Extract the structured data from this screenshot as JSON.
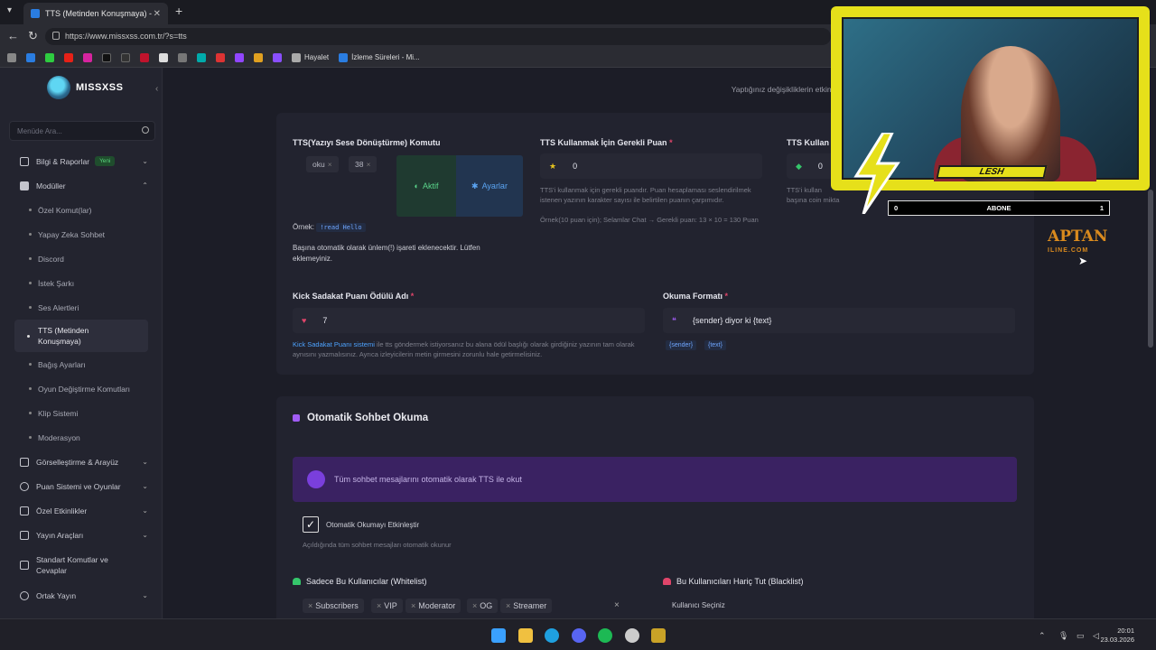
{
  "browser": {
    "tab_title": "TTS (Metinden Konuşmaya) - Mi...",
    "url": "https://www.missxss.com.tr/?s=tts",
    "bookmarks": [
      {
        "label": "Hayalet"
      },
      {
        "label": "İzleme Süreleri - Mi..."
      }
    ]
  },
  "sidebar": {
    "logo": "MISSXSS",
    "search_placeholder": "Menüde Ara...",
    "items": [
      {
        "label": "Bilgi & Raporlar",
        "badge": "Yeni"
      },
      {
        "label": "Modüller"
      },
      {
        "label": "Özel Komut(lar)"
      },
      {
        "label": "Yapay Zeka Sohbet"
      },
      {
        "label": "Discord"
      },
      {
        "label": "İstek Şarkı"
      },
      {
        "label": "Ses Alertleri"
      },
      {
        "label": "TTS (Metinden Konuşmaya)"
      },
      {
        "label": "Bağış Ayarları"
      },
      {
        "label": "Oyun Değiştirme Komutları"
      },
      {
        "label": "Klip Sistemi"
      },
      {
        "label": "Moderasyon"
      },
      {
        "label": "Görselleştirme & Arayüz"
      },
      {
        "label": "Puan Sistemi ve Oyunlar"
      },
      {
        "label": "Özel Etkinlikler"
      },
      {
        "label": "Yayın Araçları"
      },
      {
        "label": "Standart Komutlar ve Cevaplar"
      },
      {
        "label": "Ortak Yayın"
      }
    ]
  },
  "header": {
    "note": "Yaptığınız değişikliklerin etkin olması"
  },
  "tts_card": {
    "command_label": "TTS(Yazıyı Sese Dönüştürme) Komutu",
    "commands": [
      "oku",
      "38"
    ],
    "aktif_label": "Aktif",
    "ayarlar_label": "Ayarlar",
    "ornek_label": "Örnek:",
    "ornek_code": "!read Hello",
    "note": "Başına otomatik olarak ünlem(!) işareti eklenecektir. Lütfen eklemeyiniz.",
    "points_label": "TTS Kullanmak İçin Gerekli Puan",
    "points_value": "0",
    "points_help": "TTS'i kullanmak için gerekli puandır. Puan hesaplaması seslendirilmek istenen yazının karakter sayısı ile belirtilen puanın çarpımıdır.",
    "points_example": "Örnek(10 puan için); Selamlar Chat → Gerekli puan: 13 × 10 = 130 Puan",
    "third_label": "TTS Kullan",
    "third_value": "0",
    "third_help": "TTS'i kullan",
    "third_help2": "başına coin mikta",
    "reward_label": "Kick Sadakat Puanı Ödülü Adı",
    "reward_value": "7",
    "reward_help_link": "Kick Sadakat Puanı sistemi",
    "reward_help": "ile tts göndermek istiyorsanız bu alana ödül başlığı olarak girdiğiniz yazının tam olarak aynısını yazmalısınız. Ayrıca izleyicilerin metin girmesini zorunlu hale getirmelisiniz.",
    "format_label": "Okuma Formatı",
    "format_value": "{sender} diyor ki {text}",
    "format_tags": [
      "{sender}",
      "{text}"
    ]
  },
  "auto_card": {
    "title": "Otomatik Sohbet Okuma",
    "banner": "Tüm sohbet mesajlarını otomatik olarak TTS ile okut",
    "checkbox_label": "Otomatik Okumayı Etkinleştir",
    "checkbox_help": "Açıldığında tüm sohbet mesajları otomatik okunur",
    "whitelist_label": "Sadece Bu Kullanıcılar (Whitelist)",
    "whitelist_chips": [
      "Subscribers",
      "VIP",
      "Moderator",
      "OG",
      "Streamer"
    ],
    "blacklist_label": "Bu Kullanıcıları Hariç Tut (Blacklist)",
    "blacklist_placeholder": "Kullanıcı Seçiniz"
  },
  "overlay": {
    "streamer_name": "LESH",
    "abone_left": "0",
    "abone_label": "ABONE",
    "abone_right": "1",
    "aptan_top": "APTAN",
    "aptan_bottom": "ILINE.COM"
  },
  "taskbar": {
    "time": "20:01",
    "date": "23.03.2026"
  },
  "colors": {
    "accent_purple": "#a15cf5",
    "aktif_green": "#5ad48a",
    "ayarlar_blue": "#5aa4f2",
    "required_red": "#e0456a",
    "webcam_yellow": "#e6e01a"
  }
}
